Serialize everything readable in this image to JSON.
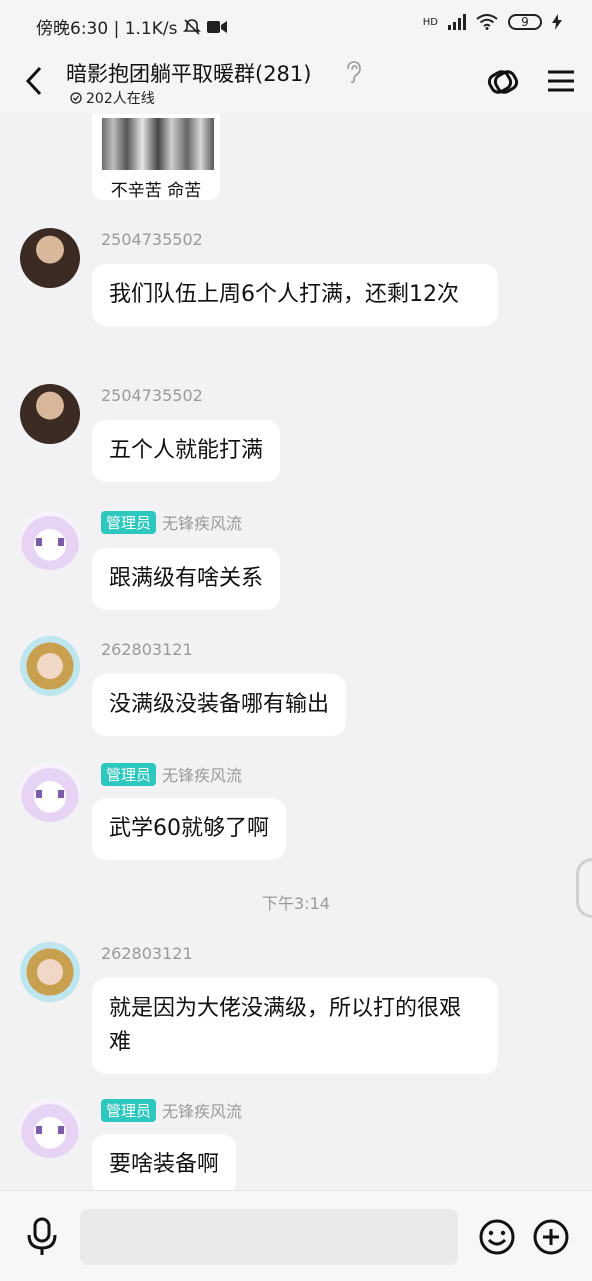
{
  "status_bar": {
    "time_net": "傍晚6:30 | 1.1K/s",
    "hd": "HD",
    "battery": "9"
  },
  "header": {
    "title": "暗影抱团躺平取暖群(281)",
    "online": "202人在线"
  },
  "image_caption": "不辛苦 命苦",
  "messages": [
    {
      "name": "2504735502",
      "text": "我们队伍上周6个人打满，还剩12次"
    },
    {
      "name": "2504735502",
      "text": "五个人就能打满"
    },
    {
      "role": "管理员",
      "name": "无锋疾风流",
      "text": "跟满级有啥关系"
    },
    {
      "name": "262803121",
      "text": "没满级没装备哪有输出"
    },
    {
      "role": "管理员",
      "name": "无锋疾风流",
      "text": "武学60就够了啊"
    },
    {
      "name": "262803121",
      "text": "就是因为大佬没满级，所以打的很艰难"
    },
    {
      "role": "管理员",
      "name": "无锋疾风流",
      "text": "要啥装备啊"
    }
  ],
  "timestamp": "下午3:14",
  "input": {
    "placeholder": ""
  },
  "colors": {
    "badge": "#2cc7be",
    "background": "#f2f2f4",
    "bubble": "#ffffff"
  }
}
